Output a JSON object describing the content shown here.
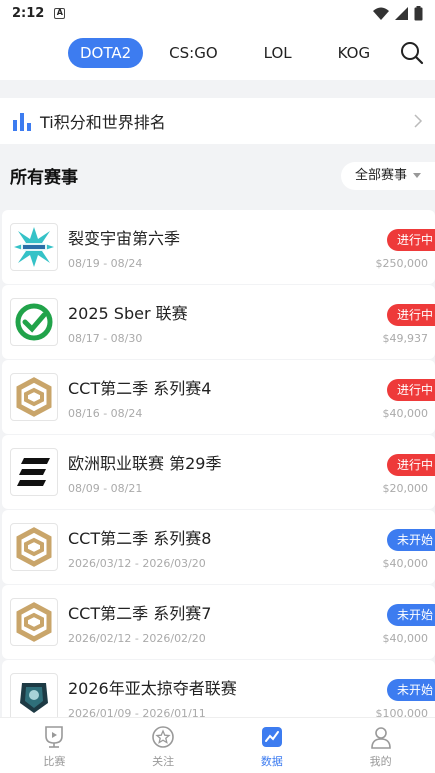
{
  "status": {
    "time": "2:12",
    "app_icon_letter": "A"
  },
  "tabs": [
    {
      "label": "DOTA2",
      "active": true
    },
    {
      "label": "CS:GO",
      "active": false
    },
    {
      "label": "LOL",
      "active": false
    },
    {
      "label": "KOG",
      "active": false
    }
  ],
  "ranking": {
    "label": "Ti积分和世界排名"
  },
  "section": {
    "title": "所有赛事",
    "filter_label": "全部赛事"
  },
  "tournaments": [
    {
      "name": "裂变宇宙第六季",
      "dates": "08/19 - 08/24",
      "status": "进行中",
      "prize": "$250,000",
      "logo": "splash-logo-icon"
    },
    {
      "name": "2025 Sber 联赛",
      "dates": "08/17 - 08/30",
      "status": "进行中",
      "prize": "$49,937",
      "logo": "check-circle-logo-icon"
    },
    {
      "name": "CCT第二季 系列赛4",
      "dates": "08/16 - 08/24",
      "status": "进行中",
      "prize": "$40,000",
      "logo": "cct-logo-icon"
    },
    {
      "name": "欧洲职业联赛 第29季",
      "dates": "08/09 - 08/21",
      "status": "进行中",
      "prize": "$20,000",
      "logo": "epl-logo-icon"
    },
    {
      "name": "CCT第二季 系列赛8",
      "dates": "2026/03/12 - 2026/03/20",
      "status": "未开始",
      "prize": "$40,000",
      "logo": "cct-logo-icon"
    },
    {
      "name": "CCT第二季 系列赛7",
      "dates": "2026/02/12 - 2026/02/20",
      "status": "未开始",
      "prize": "$40,000",
      "logo": "cct-logo-icon"
    },
    {
      "name": "2026年亚太掠夺者联赛",
      "dates": "2026/01/09 - 2026/01/11",
      "status": "未开始",
      "prize": "$100,000",
      "logo": "predator-logo-icon"
    }
  ],
  "bottom_nav": [
    {
      "label": "比赛",
      "icon": "trophy-play-icon",
      "active": false
    },
    {
      "label": "关注",
      "icon": "star-circle-icon",
      "active": false
    },
    {
      "label": "数据",
      "icon": "chart-icon",
      "active": true
    },
    {
      "label": "我的",
      "icon": "person-icon",
      "active": false
    }
  ],
  "colors": {
    "accent": "#3d7cf0",
    "live": "#ee3a3a",
    "muted": "#aaaaaa"
  }
}
